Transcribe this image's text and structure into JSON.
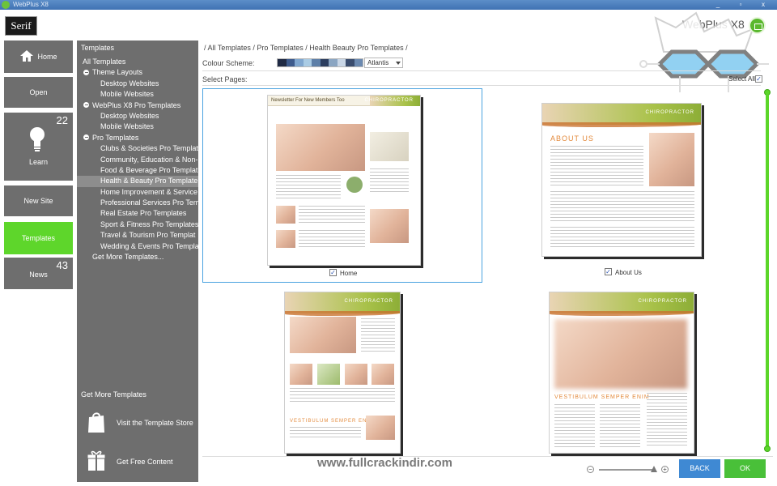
{
  "window": {
    "title": "WebPlus X8",
    "controls": [
      "minimize",
      "restore",
      "close"
    ]
  },
  "header": {
    "logo": "Serif",
    "product": "WebPlus X8"
  },
  "nav": {
    "home": "Home",
    "open": "Open",
    "learn": "Learn",
    "learn_count": "22",
    "new_site": "New Site",
    "templates": "Templates",
    "news": "News",
    "news_count": "43"
  },
  "panel": {
    "title": "Templates",
    "tree": [
      {
        "label": "All Templates",
        "indent": 0
      },
      {
        "label": "Theme Layouts",
        "indent": 1,
        "expander": true
      },
      {
        "label": "Desktop Websites",
        "indent": 2
      },
      {
        "label": "Mobile Websites",
        "indent": 2
      },
      {
        "label": "WebPlus X8 Pro Templates",
        "indent": 1,
        "expander": true
      },
      {
        "label": "Desktop Websites",
        "indent": 2
      },
      {
        "label": "Mobile Websites",
        "indent": 2
      },
      {
        "label": "Pro Templates",
        "indent": 1,
        "expander": true
      },
      {
        "label": "Clubs & Societies Pro Templat",
        "indent": 2
      },
      {
        "label": "Community, Education & Non-",
        "indent": 2
      },
      {
        "label": "Food & Beverage Pro Templat",
        "indent": 2
      },
      {
        "label": "Health & Beauty Pro Template",
        "indent": 2,
        "selected": true
      },
      {
        "label": "Home Improvement & Service",
        "indent": 2
      },
      {
        "label": "Professional Services Pro Tem",
        "indent": 2
      },
      {
        "label": "Real Estate Pro Templates",
        "indent": 2
      },
      {
        "label": "Sport & Fitness Pro Templates",
        "indent": 2
      },
      {
        "label": "Travel & Tourism Pro Templat",
        "indent": 2
      },
      {
        "label": "Wedding & Events Pro Templa",
        "indent": 2
      },
      {
        "label": "Get More Templates...",
        "indent": 1
      }
    ],
    "more_title": "Get More Templates",
    "store_label": "Visit the Template Store",
    "free_label": "Get Free Content"
  },
  "main": {
    "breadcrumb": "/ All Templates / Pro Templates / Health  Beauty Pro Templates /",
    "colour_label": "Colour Scheme:",
    "swatches": [
      "#1f2a44",
      "#3d5a8c",
      "#7fa6cf",
      "#a9cbe4",
      "#5d7fa8",
      "#2c3e5f",
      "#8aa5c2",
      "#c9d6e6",
      "#3a4c6e",
      "#6b89b0"
    ],
    "scheme_value": "Atlantis",
    "select_pages_label": "Select Pages:",
    "select_all_label": "Select All",
    "select_all_checked": "✓",
    "pages": [
      {
        "label": "Home",
        "checked": "✓",
        "banner_title": "CHIROPRACTOR",
        "strip_text": "Newsletter For New Members Too",
        "heading": "",
        "body": "Lorem ipsum dolor sit amet"
      },
      {
        "label": "About Us",
        "checked": "✓",
        "banner_title": "CHIROPRACTOR",
        "heading": "ABOUT US",
        "body": "Lorem ipsum dolor sit amet"
      },
      {
        "label": "",
        "checked": "",
        "banner_title": "CHIROPRACTOR",
        "heading": "VESTIBULUM SEMPER ENIM",
        "body": "Lorem ipsum dolor sit amet"
      },
      {
        "label": "",
        "checked": "",
        "banner_title": "CHIROPRACTOR",
        "heading": "VESTIBULUM SEMPER ENIM",
        "body": "Lorem ipsum dolor sit amet"
      }
    ],
    "watermark": "www.fullcrackindir.com"
  },
  "footer": {
    "zoom_minus": "−",
    "zoom_plus": "+",
    "back": "BACK",
    "ok": "OK"
  },
  "colors": {
    "active_tile": "#5ed62b",
    "panel_bg": "#6e6e6e",
    "back_button": "#3f89d3",
    "ok_button": "#49c039",
    "selection_border": "#4aa3e0"
  }
}
